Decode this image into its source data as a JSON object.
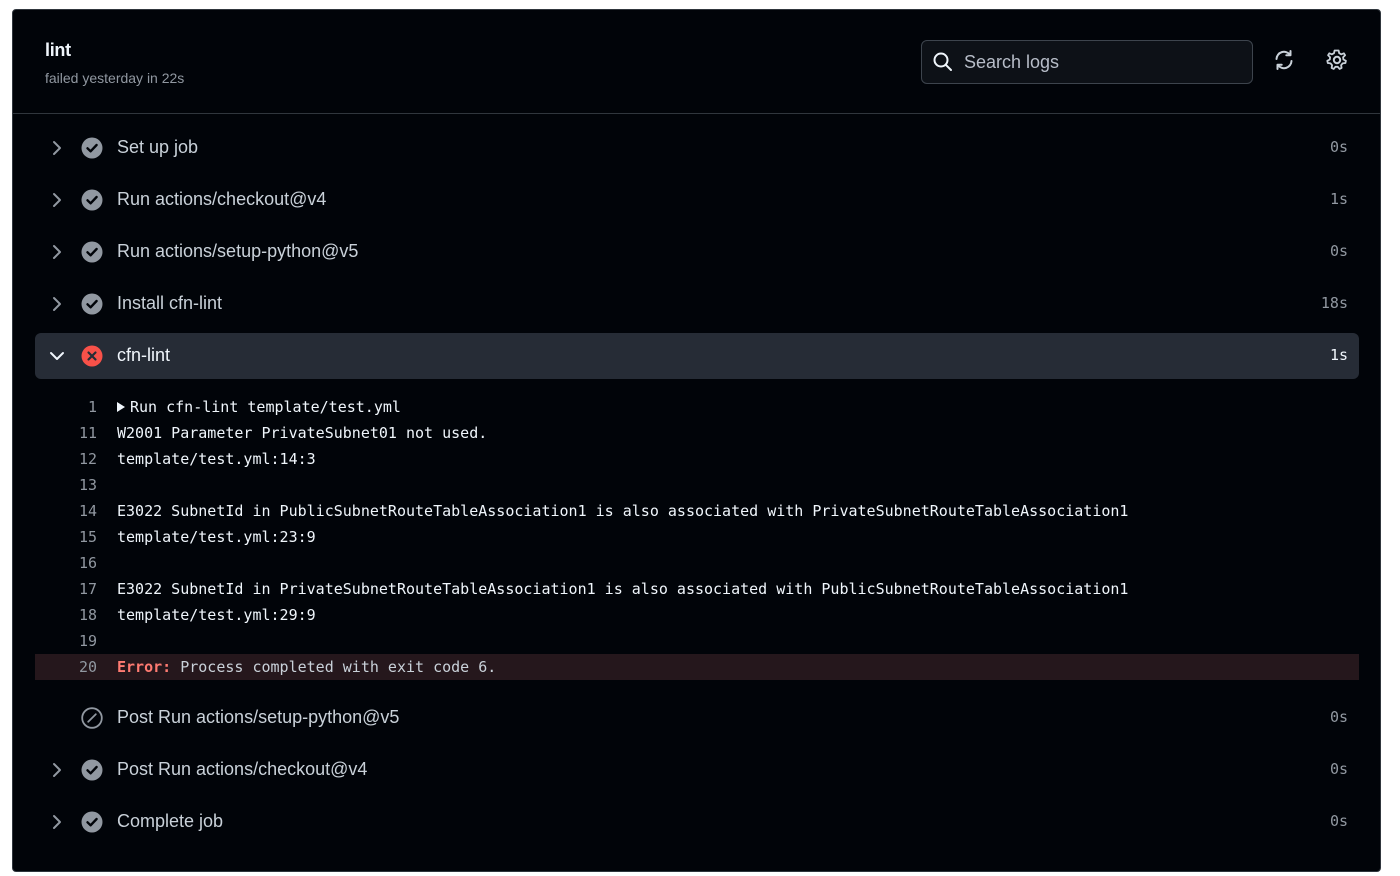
{
  "job": {
    "title": "lint",
    "subtitle": "failed yesterday in 22s"
  },
  "search": {
    "placeholder": "Search logs"
  },
  "header_icons": {
    "refresh": "sync-icon",
    "settings": "gear-icon"
  },
  "steps": [
    {
      "name": "Set up job",
      "duration": "0s",
      "status": "success",
      "expanded": false
    },
    {
      "name": "Run actions/checkout@v4",
      "duration": "1s",
      "status": "success",
      "expanded": false
    },
    {
      "name": "Run actions/setup-python@v5",
      "duration": "0s",
      "status": "success",
      "expanded": false
    },
    {
      "name": "Install cfn-lint",
      "duration": "18s",
      "status": "success",
      "expanded": false
    },
    {
      "name": "cfn-lint",
      "duration": "1s",
      "status": "failure",
      "expanded": true
    },
    {
      "name": "Post Run actions/setup-python@v5",
      "duration": "0s",
      "status": "skipped",
      "expanded": false
    },
    {
      "name": "Post Run actions/checkout@v4",
      "duration": "0s",
      "status": "success",
      "expanded": false
    },
    {
      "name": "Complete job",
      "duration": "0s",
      "status": "success",
      "expanded": false
    }
  ],
  "log": {
    "lines": [
      {
        "num": "1",
        "text": "Run cfn-lint template/test.yml",
        "group": true
      },
      {
        "num": "11",
        "text": "W2001 Parameter PrivateSubnet01 not used."
      },
      {
        "num": "12",
        "text": "template/test.yml:14:3"
      },
      {
        "num": "13",
        "text": ""
      },
      {
        "num": "14",
        "text": "E3022 SubnetId in PublicSubnetRouteTableAssociation1 is also associated with PrivateSubnetRouteTableAssociation1"
      },
      {
        "num": "15",
        "text": "template/test.yml:23:9"
      },
      {
        "num": "16",
        "text": ""
      },
      {
        "num": "17",
        "text": "E3022 SubnetId in PrivateSubnetRouteTableAssociation1 is also associated with PublicSubnetRouteTableAssociation1"
      },
      {
        "num": "18",
        "text": "template/test.yml:29:9"
      },
      {
        "num": "19",
        "text": ""
      },
      {
        "num": "20",
        "error_label": "Error:",
        "text": " Process completed with exit code 6.",
        "error": true
      }
    ]
  },
  "colors": {
    "background": "#010409",
    "success": "#9198a1",
    "failure": "#f85149",
    "error_row": "#25171c"
  }
}
